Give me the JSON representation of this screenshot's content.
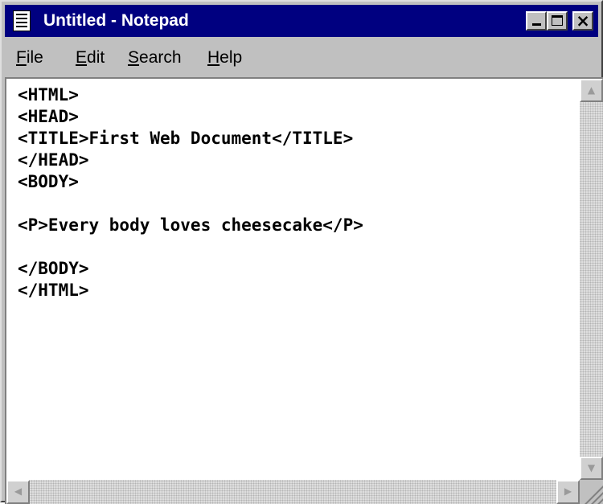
{
  "window": {
    "title": "Untitled - Notepad",
    "icons": {
      "app": "notepad-icon",
      "minimize": "minimize-icon",
      "maximize": "maximize-icon",
      "close": "close-icon"
    },
    "close_glyph": "×"
  },
  "menu": {
    "items": [
      {
        "mnemonic": "F",
        "rest": "ile"
      },
      {
        "mnemonic": "E",
        "rest": "dit"
      },
      {
        "mnemonic": "S",
        "rest": "earch"
      },
      {
        "mnemonic": "H",
        "rest": "elp"
      }
    ]
  },
  "editor": {
    "text": "<HTML>\n<HEAD>\n<TITLE>First Web Document</TITLE>\n</HEAD>\n<BODY>\n\n<P>Every body loves cheesecake</P>\n\n</BODY>\n</HTML>"
  },
  "scrollbars": {
    "up_arrow": "▲",
    "down_arrow": "▼",
    "left_arrow": "◀",
    "right_arrow": "▶"
  },
  "colors": {
    "titlebar": "#000080",
    "face": "#c0c0c0",
    "editor_bg": "#ffffff"
  }
}
